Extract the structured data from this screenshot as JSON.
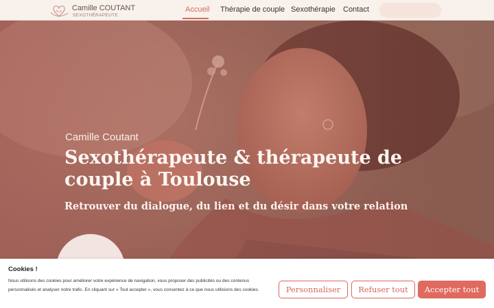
{
  "header": {
    "logo_name": "Camille COUTANT",
    "logo_subtitle": "SEXOTHÉRAPEUTE",
    "nav": [
      {
        "label": "Accueil",
        "active": true
      },
      {
        "label": "Thérapie de couple",
        "active": false
      },
      {
        "label": "Sexothérapie",
        "active": false
      },
      {
        "label": "Contact",
        "active": false
      }
    ]
  },
  "hero": {
    "kicker": "Camille Coutant",
    "title": "Sexothérapeute & thérapeute de couple à Toulouse",
    "subtitle": "Retrouver du dialogue, du lien et du désir dans votre relation"
  },
  "cookies": {
    "title": "Cookies !",
    "text": "Nous utilisons des cookies pour améliorer votre expérience de navigation, vous proposer des publicités ou des contenus personnalisés et analyser notre trafic. En cliquant sur « Tout accepter », vous consentez à ce que nous utilisions des cookies.",
    "buttons": {
      "customize": "Personnaliser",
      "refuse": "Refuser tout",
      "accept": "Accepter tout"
    }
  },
  "colors": {
    "accent": "#d46a5f",
    "overlay": "#b0605c",
    "header_bg": "#f8f1ec"
  }
}
